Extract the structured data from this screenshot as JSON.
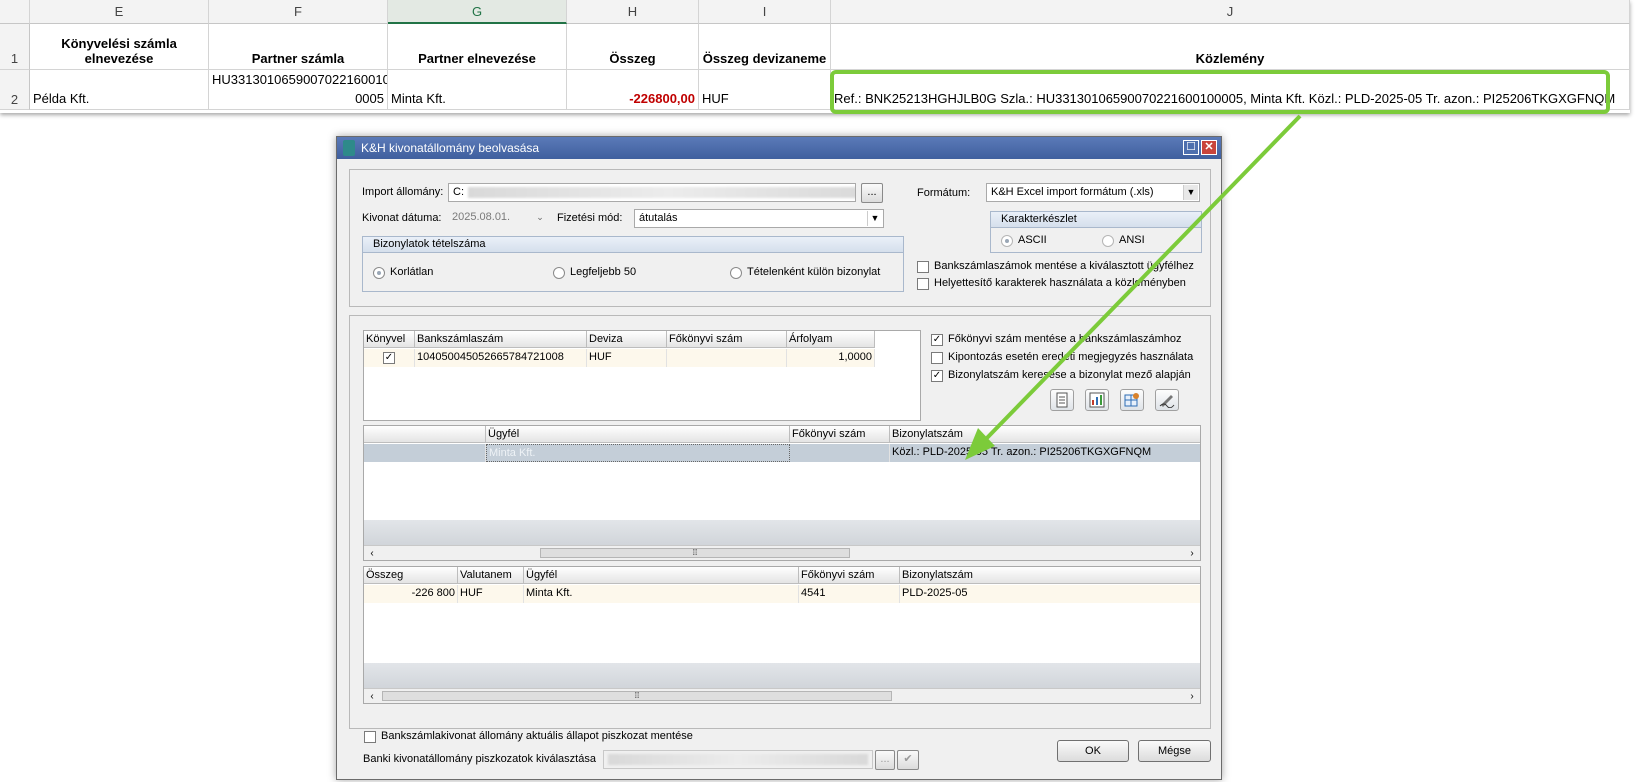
{
  "sheet": {
    "col_headers": [
      "E",
      "F",
      "G",
      "H",
      "I",
      "J"
    ],
    "row_numbers": [
      "1",
      "2"
    ],
    "headers": {
      "e": "Könyvelési számla elnevezése",
      "f": "Partner számla",
      "g": "Partner elnevezése",
      "h": "Összeg",
      "i": "Összeg devizaneme",
      "j": "Közlemény"
    },
    "row2": {
      "e": "Példa Kft.",
      "f_line1": "HU331301065900702216001​0",
      "f_line2": "0005",
      "g": "Minta Kft.",
      "h": "-226800,00",
      "i": "HUF",
      "j": "Ref.: BNK25213HGHJLB0G Szla.: HU33130106590070221600100005, Minta Kft. Közl.: PLD-2025-05 Tr. azon.: PI25206TKGXGFNQM"
    }
  },
  "dialog": {
    "title": "K&H kivonatállomány beolvasása",
    "import_label": "Import állomány:",
    "import_value": "C:",
    "browse_label": "...",
    "format_label": "Formátum:",
    "format_value": "K&H Excel import formátum (.xls)",
    "date_label": "Kivonat dátuma:",
    "date_value": "2025.08.01.",
    "payment_label": "Fizetési mód:",
    "payment_value": "átutalás",
    "charset_title": "Karakterkészlet",
    "charset_options": [
      "ASCII",
      "ANSI"
    ],
    "items_title": "Bizonylatok tételszáma",
    "items_options": [
      "Korlátlan",
      "Legfeljebb 50",
      "Tételenként külön bizonylat"
    ],
    "opt_save_accounts": "Bankszámlaszámok mentése a kiválasztott ügyfélhez",
    "opt_replace_chars": "Helyettesítő karakterek használata a közleményben",
    "opt_save_ledger": "Főkönyvi szám mentése a bankszámlaszámhoz",
    "opt_centralize": "Kipontozás esetén eredeti megjegyzés használata",
    "opt_voucher": "Bizonylatszám keresése a bizonylat mező alapján",
    "accounts_grid": {
      "columns": [
        "Könyvel",
        "Bankszámlaszám",
        "Deviza",
        "Főkönyvi szám",
        "Árfolyam"
      ],
      "row": {
        "account": "10405004505266578472100​8",
        "currency": "HUF",
        "ledger": "",
        "rate": "1,0000"
      }
    },
    "client_grid": {
      "columns": [
        "",
        "Ügyfél",
        "Főkönyvi szám",
        "Bizonylatszám"
      ],
      "row": {
        "client": "Minta Kft.",
        "ledger": "",
        "voucher": "Közl.: PLD-2025-05 Tr. azon.: PI25206TKGXGFNQM"
      }
    },
    "items_grid": {
      "columns": [
        "Összeg",
        "Valutanem",
        "Ügyfél",
        "Főkönyvi szám",
        "Bizonylatszám"
      ],
      "row": {
        "amount": "-226 800",
        "currency": "HUF",
        "client": "Minta Kft.",
        "ledger": "4541",
        "voucher": "PLD-2025-05"
      }
    },
    "draft_save_label": "Bankszámlakivonat állomány aktuális állapot piszkozat mentése",
    "draft_select_label": "Banki kivonatállomány piszkozatok kiválasztása",
    "ok_label": "OK",
    "cancel_label": "Mégse"
  },
  "colors": {
    "highlight": "#7ccb3a",
    "negative": "#c00000",
    "title_bar": "#4a6aa8"
  }
}
